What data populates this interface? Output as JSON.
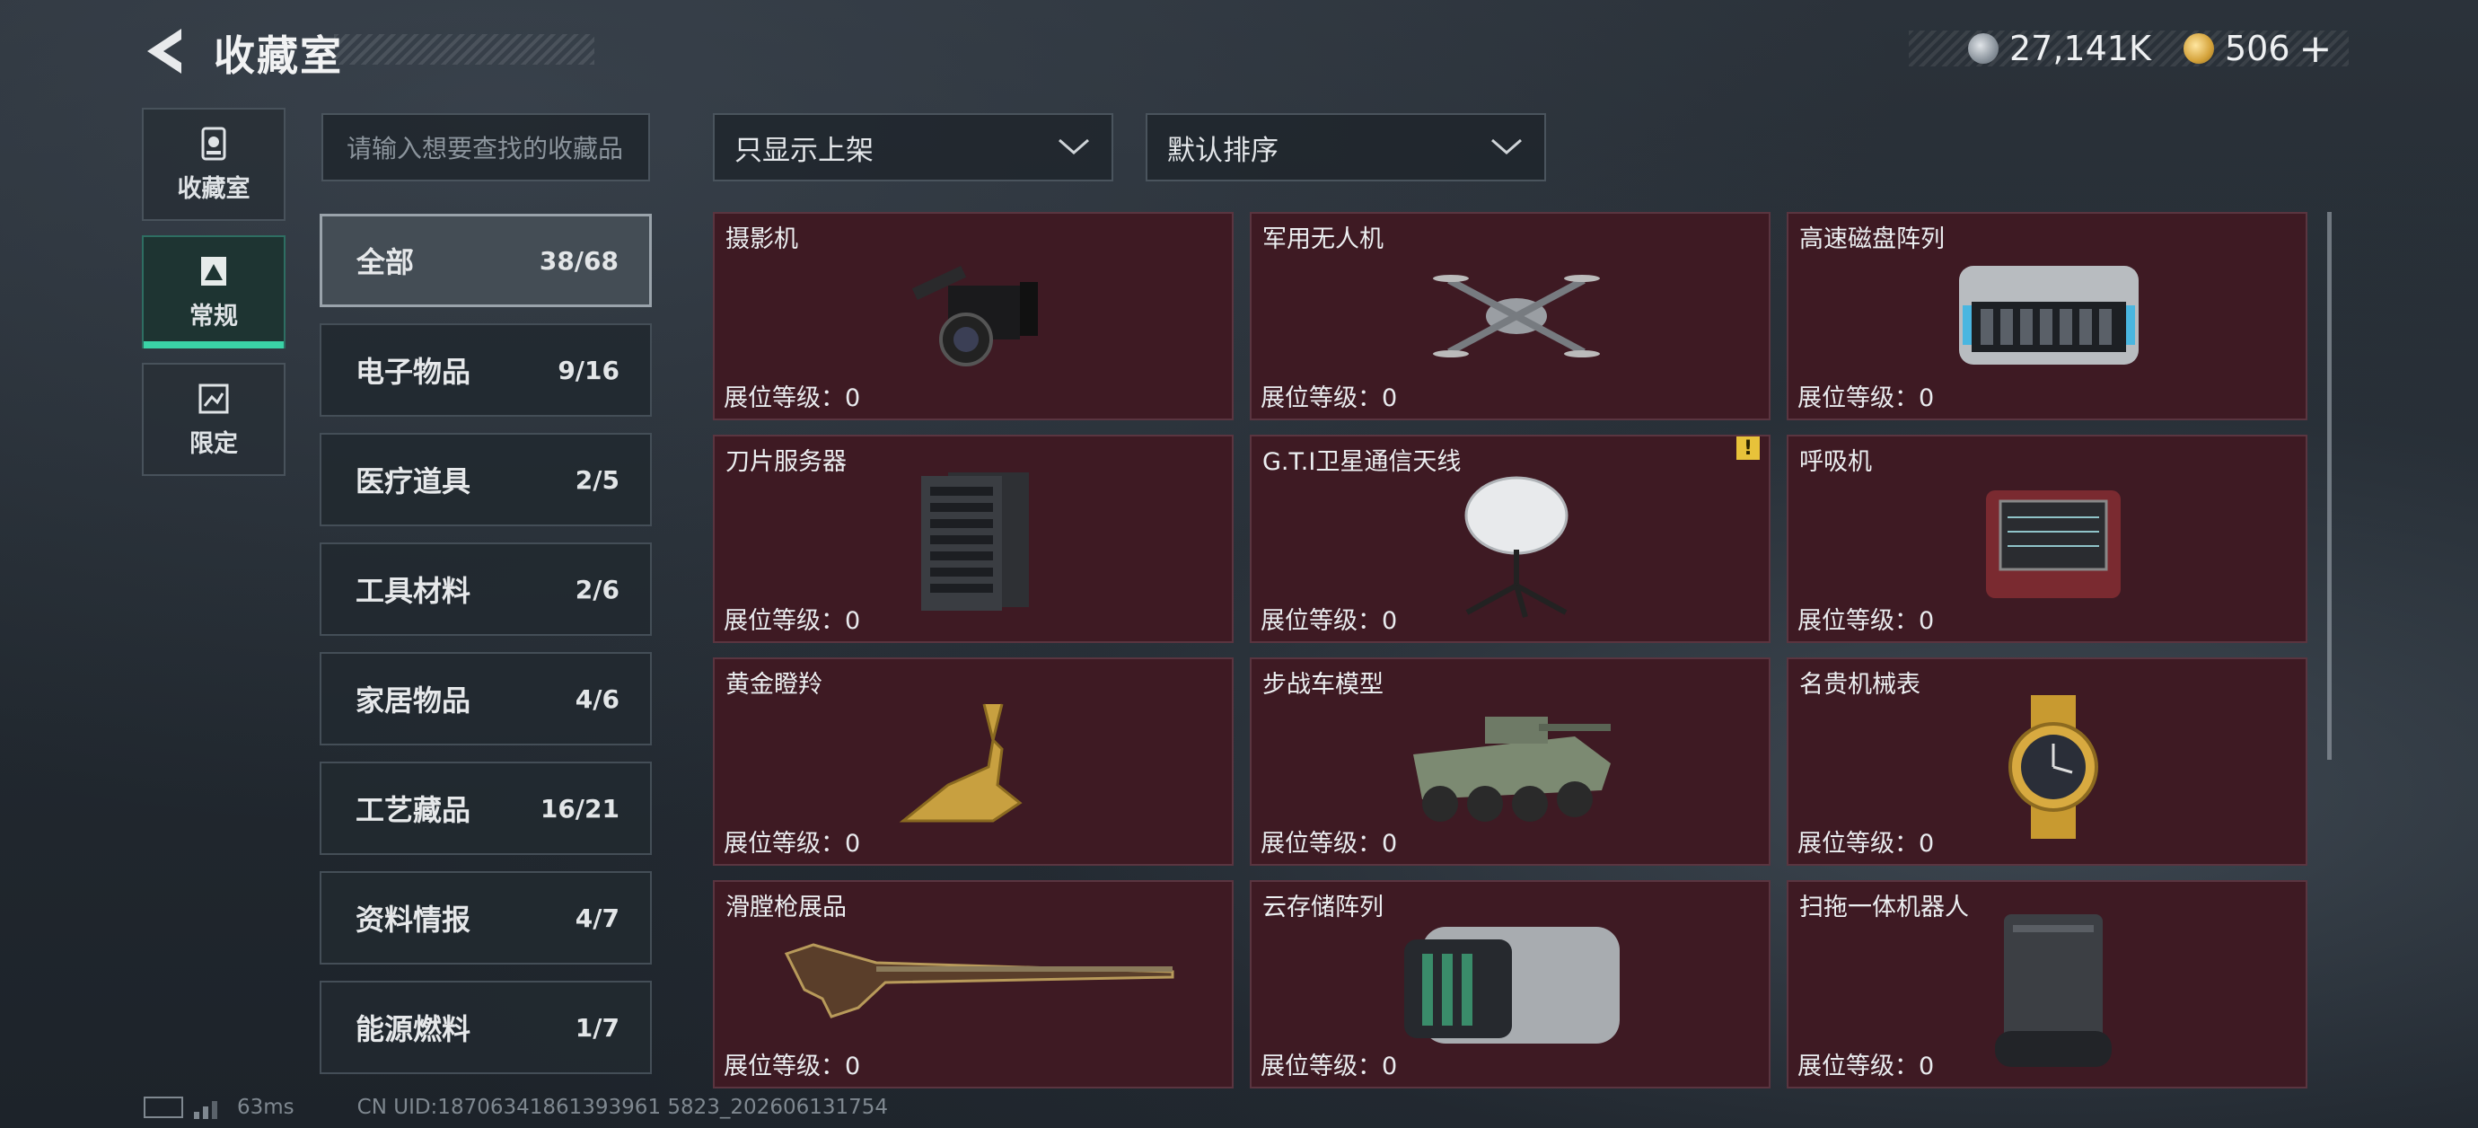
{
  "header": {
    "title": "收藏室",
    "currency": [
      {
        "icon": "silver-coin-icon",
        "value": "27,141K"
      },
      {
        "icon": "gold-coin-icon",
        "value": "506"
      }
    ],
    "add_label": "+"
  },
  "left_tabs": [
    {
      "label": "收藏室",
      "icon": "collection-room-icon",
      "active": false
    },
    {
      "label": "常规",
      "icon": "regular-icon",
      "active": true
    },
    {
      "label": "限定",
      "icon": "limited-icon",
      "active": false
    }
  ],
  "search": {
    "placeholder": "请输入想要查找的收藏品"
  },
  "categories": [
    {
      "label": "全部",
      "count": "38/68",
      "active": true
    },
    {
      "label": "电子物品",
      "count": "9/16"
    },
    {
      "label": "医疗道具",
      "count": "2/5"
    },
    {
      "label": "工具材料",
      "count": "2/6"
    },
    {
      "label": "家居物品",
      "count": "4/6"
    },
    {
      "label": "工艺藏品",
      "count": "16/21"
    },
    {
      "label": "资料情报",
      "count": "4/7"
    },
    {
      "label": "能源燃料",
      "count": "1/7"
    }
  ],
  "filters": {
    "filter_dropdown": "只显示上架",
    "sort_dropdown": "默认排序"
  },
  "items": [
    {
      "name": "摄影机",
      "level": "展位等级：0",
      "icon": "camera-icon"
    },
    {
      "name": "军用无人机",
      "level": "展位等级：0",
      "icon": "drone-icon"
    },
    {
      "name": "高速磁盘阵列",
      "level": "展位等级：0",
      "icon": "disk-array-icon"
    },
    {
      "name": "刀片服务器",
      "level": "展位等级：0",
      "icon": "blade-server-icon"
    },
    {
      "name": "G.T.I卫星通信天线",
      "level": "展位等级：0",
      "icon": "satellite-antenna-icon",
      "warning": "!"
    },
    {
      "name": "呼吸机",
      "level": "展位等级：0",
      "icon": "ventilator-icon"
    },
    {
      "name": "黄金瞪羚",
      "level": "展位等级：0",
      "icon": "golden-gazelle-icon"
    },
    {
      "name": "步战车模型",
      "level": "展位等级：0",
      "icon": "ifv-model-icon"
    },
    {
      "name": "名贵机械表",
      "level": "展位等级：0",
      "icon": "mechanical-watch-icon"
    },
    {
      "name": "滑膛枪展品",
      "level": "展位等级：0",
      "icon": "musket-icon"
    },
    {
      "name": "云存储阵列",
      "level": "展位等级：0",
      "icon": "cloud-storage-icon"
    },
    {
      "name": "扫拖一体机器人",
      "level": "展位等级：0",
      "icon": "mop-robot-icon"
    }
  ],
  "footer": {
    "ping": "63ms",
    "uid": "CN UID:18706341861393961 5823_202606131754"
  },
  "colors": {
    "card_bg": "#3e1a23",
    "active_tab_accent": "#3ad2a6",
    "warning": "#e8c23a"
  }
}
